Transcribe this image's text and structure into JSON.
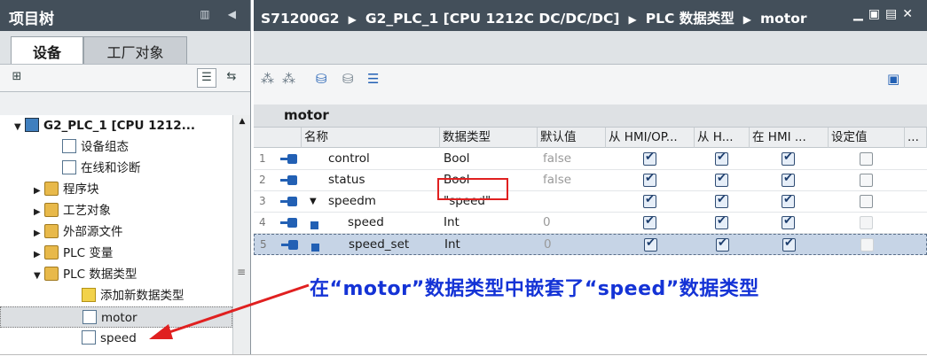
{
  "left_panel": {
    "title": "项目树",
    "tabs": [
      "设备",
      "工厂对象"
    ],
    "tree": [
      {
        "label": "G2_PLC_1 [CPU 1212...",
        "arrow": "▼",
        "icon": "plc-icon",
        "bold": true
      },
      {
        "label": "设备组态",
        "arrow": "",
        "icon": "device-config-icon"
      },
      {
        "label": "在线和诊断",
        "arrow": "",
        "icon": "online-diagnostics-icon"
      },
      {
        "label": "程序块",
        "arrow": "▶",
        "icon": "folder-icon"
      },
      {
        "label": "工艺对象",
        "arrow": "▶",
        "icon": "folder-icon"
      },
      {
        "label": "外部源文件",
        "arrow": "▶",
        "icon": "folder-icon"
      },
      {
        "label": "PLC 变量",
        "arrow": "▶",
        "icon": "folder-icon"
      },
      {
        "label": "PLC 数据类型",
        "arrow": "▼",
        "icon": "folder-icon"
      },
      {
        "label": "添加新数据类型",
        "arrow": "",
        "icon": "add-datatype-icon"
      },
      {
        "label": "motor",
        "arrow": "",
        "icon": "datatype-icon",
        "selected": true
      },
      {
        "label": "speed",
        "arrow": "",
        "icon": "datatype-icon"
      }
    ]
  },
  "breadcrumb": [
    "S71200G2",
    "G2_PLC_1 [CPU 1212C DC/DC/DC]",
    "PLC 数据类型",
    "motor"
  ],
  "editor": {
    "object_name": "motor",
    "columns": [
      "名称",
      "数据类型",
      "默认值",
      "从 HMI/OP...",
      "从 H...",
      "在 HMI ...",
      "设定值",
      "..."
    ],
    "rows": [
      {
        "num": "1",
        "name": "control",
        "type": "Bool",
        "default": "false",
        "hmi1": true,
        "hmi2": true,
        "hmi3": true,
        "setpoint": false,
        "sub": false,
        "expander": ""
      },
      {
        "num": "2",
        "name": "status",
        "type": "Bool",
        "default": "false",
        "hmi1": true,
        "hmi2": true,
        "hmi3": true,
        "setpoint": false,
        "sub": false,
        "expander": ""
      },
      {
        "num": "3",
        "name": "speedm",
        "type": "\"speed\"",
        "default": "",
        "hmi1": true,
        "hmi2": true,
        "hmi3": true,
        "setpoint": false,
        "sub": false,
        "expander": "▼"
      },
      {
        "num": "4",
        "name": "speed",
        "type": "Int",
        "default": "0",
        "hmi1": true,
        "hmi2": true,
        "hmi3": true,
        "setpoint": false,
        "sub": true,
        "expander": ""
      },
      {
        "num": "5",
        "name": "speed_set",
        "type": "Int",
        "default": "0",
        "hmi1": true,
        "hmi2": true,
        "hmi3": true,
        "setpoint": false,
        "sub": true,
        "expander": "",
        "selected": true
      }
    ]
  },
  "annotation": "在“motor”数据类型中嵌套了“speed”数据类型",
  "colors": {
    "titlebar": "#434f5a",
    "accent_blue": "#1433d6",
    "highlight_red": "#e02020"
  }
}
